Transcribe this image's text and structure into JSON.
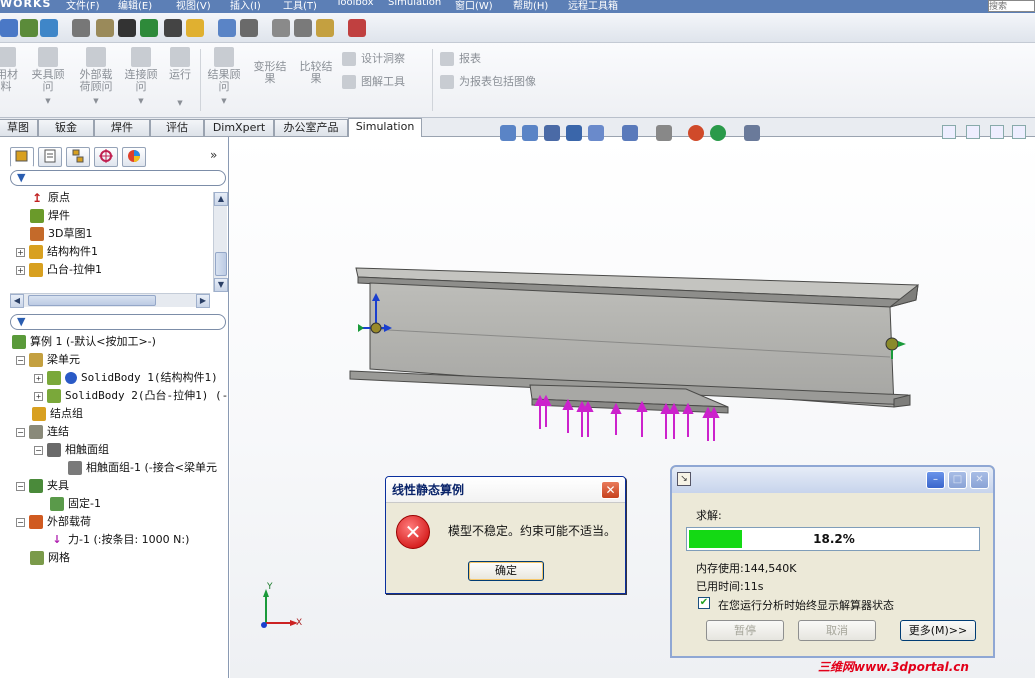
{
  "menubar": {
    "brand": "WORKS",
    "items": [
      "文件(F)",
      "编辑(E)",
      "视图(V)",
      "插入(I)",
      "工具(T)",
      "Toolbox",
      "Simulation",
      "窗口(W)",
      "帮助(H)",
      "远程工具箱"
    ],
    "search_placeholder": "搜索"
  },
  "command_manager": {
    "buttons": [
      {
        "label": "用材\n料"
      },
      {
        "label": "夹具顾\n问"
      },
      {
        "label": "外部载\n荷顾问"
      },
      {
        "label": "连接顾\n问"
      },
      {
        "label": "运行"
      },
      {
        "label": "结果顾\n问"
      },
      {
        "label": "变形结\n果"
      },
      {
        "label": "比较结\n果"
      }
    ],
    "small": {
      "design_study": "设计洞察",
      "plot_tools": "图解工具",
      "report": "报表",
      "include_image": "为报表包括图像"
    }
  },
  "tabs": [
    "草图",
    "钣金",
    "焊件",
    "评估",
    "DimXpert",
    "办公室产品",
    "Simulation"
  ],
  "active_tab": "Simulation",
  "feature_tree": {
    "items": [
      "原点",
      "焊件",
      "3D草图1",
      "结构构件1",
      "凸台-拉伸1"
    ]
  },
  "sim_tree": {
    "items": [
      {
        "label": "算例 1 (-默认<按加工>-)",
        "depth": 0
      },
      {
        "label": "梁单元",
        "depth": 1
      },
      {
        "label": "SolidBody 1(结构构件1)",
        "depth": 2
      },
      {
        "label": "SolidBody 2(凸台-拉伸1) (-(",
        "depth": 2
      },
      {
        "label": "结点组",
        "depth": 1
      },
      {
        "label": "连结",
        "depth": 1
      },
      {
        "label": "相触面组",
        "depth": 2
      },
      {
        "label": "相触面组-1 (-接合<梁单元",
        "depth": 3
      },
      {
        "label": "夹具",
        "depth": 1
      },
      {
        "label": "固定-1",
        "depth": 2
      },
      {
        "label": "外部载荷",
        "depth": 1
      },
      {
        "label": "力-1 (:按条目: 1000 N:)",
        "depth": 2
      },
      {
        "label": "网格",
        "depth": 1
      }
    ]
  },
  "triad": {
    "x": "X",
    "y": "Y"
  },
  "error_dialog": {
    "title": "线性静态算例",
    "message": "模型不稳定。约束可能不适当。",
    "ok_label": "确定",
    "icon": "error-icon"
  },
  "solver_dialog": {
    "label_solving": "求解:",
    "progress_text": "18.2%",
    "progress_fraction": 0.182,
    "memory": "内存使用:144,540K",
    "elapsed": "已用时间:11s",
    "checkbox_label": "在您运行分析时始终显示解算器状态",
    "checkbox_checked": true,
    "pause_label": "暂停",
    "cancel_label": "取消",
    "more_label": "更多(M)>>"
  },
  "watermark": "三维网www.3dportal.cn",
  "colors": {
    "load_arrow": "#cc22cc",
    "progress": "#14d914",
    "beam": "#a9a9a6"
  }
}
